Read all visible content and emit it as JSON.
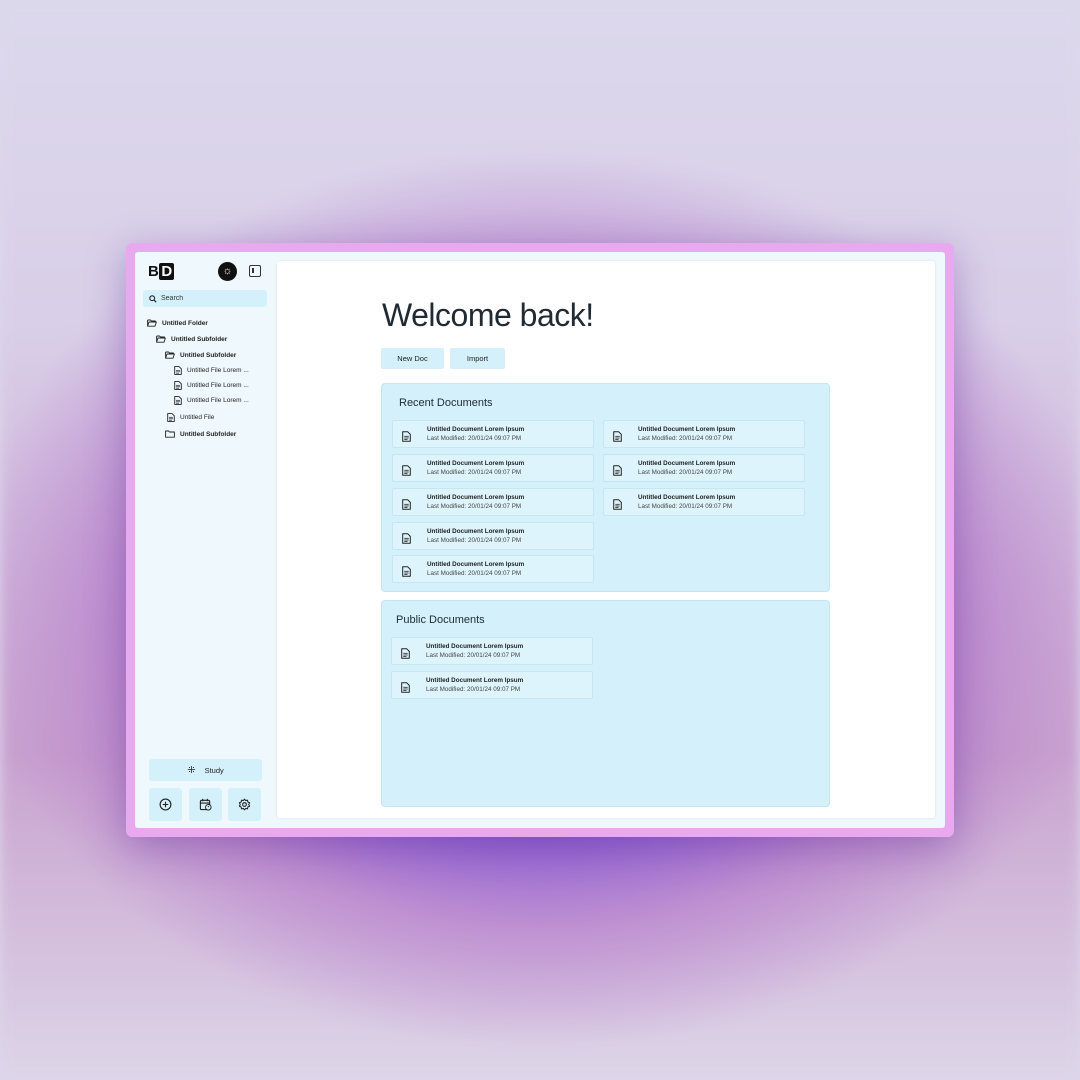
{
  "sidebar": {
    "logo": {
      "b": "B",
      "d": "D"
    },
    "search_placeholder": "Search",
    "tree": [
      {
        "label": "Untitled Folder",
        "type": "folder-open"
      },
      {
        "label": "Untitled Subfolder",
        "type": "folder-open"
      },
      {
        "label": "Untitled Subfolder",
        "type": "folder-open"
      },
      {
        "label": "Untitled File Lorem ...",
        "type": "file"
      },
      {
        "label": "Untitled File Lorem ...",
        "type": "file"
      },
      {
        "label": "Untitled File Lorem ...",
        "type": "file"
      },
      {
        "label": "Untitled File",
        "type": "file"
      },
      {
        "label": "Untitled Subfolder",
        "type": "folder"
      }
    ],
    "study_label": "Study",
    "bottom_icons": [
      "plus-circle-icon",
      "calendar-clock-icon",
      "gear-icon"
    ]
  },
  "main": {
    "welcome": "Welcome back!",
    "buttons": {
      "new_doc": "New Doc",
      "import": "Import"
    },
    "recent": {
      "title": "Recent Documents",
      "docs": [
        {
          "title": "Untitled Document Lorem Ipsum",
          "modified": "Last Modified: 20/01/24 09:07 PM"
        },
        {
          "title": "Untitled Document Lorem Ipsum",
          "modified": "Last Modified: 20/01/24 09:07 PM"
        },
        {
          "title": "Untitled Document Lorem Ipsum",
          "modified": "Last Modified: 20/01/24 09:07 PM"
        },
        {
          "title": "Untitled Document Lorem Ipsum",
          "modified": "Last Modified: 20/01/24 09:07 PM"
        },
        {
          "title": "Untitled Document Lorem Ipsum",
          "modified": "Last Modified: 20/01/24 09:07 PM"
        },
        {
          "title": "Untitled Document Lorem Ipsum",
          "modified": "Last Modified: 20/01/24 09:07 PM"
        },
        {
          "title": "Untitled Document Lorem Ipsum",
          "modified": "Last Modified: 20/01/24 09:07 PM"
        },
        {
          "title": "Untitled Document Lorem Ipsum",
          "modified": "Last Modified: 20/01/24 09:07 PM"
        }
      ]
    },
    "public": {
      "title": "Public Documents",
      "docs": [
        {
          "title": "Untitled Document Lorem Ipsum",
          "modified": "Last Modified: 20/01/24 09:07 PM"
        },
        {
          "title": "Untitled Document Lorem Ipsum",
          "modified": "Last Modified: 20/01/24 09:07 PM"
        }
      ]
    }
  },
  "colors": {
    "accent_panel": "#d3f0fb",
    "frame": "#e9a9ef",
    "text_dark": "#1f2a33"
  }
}
